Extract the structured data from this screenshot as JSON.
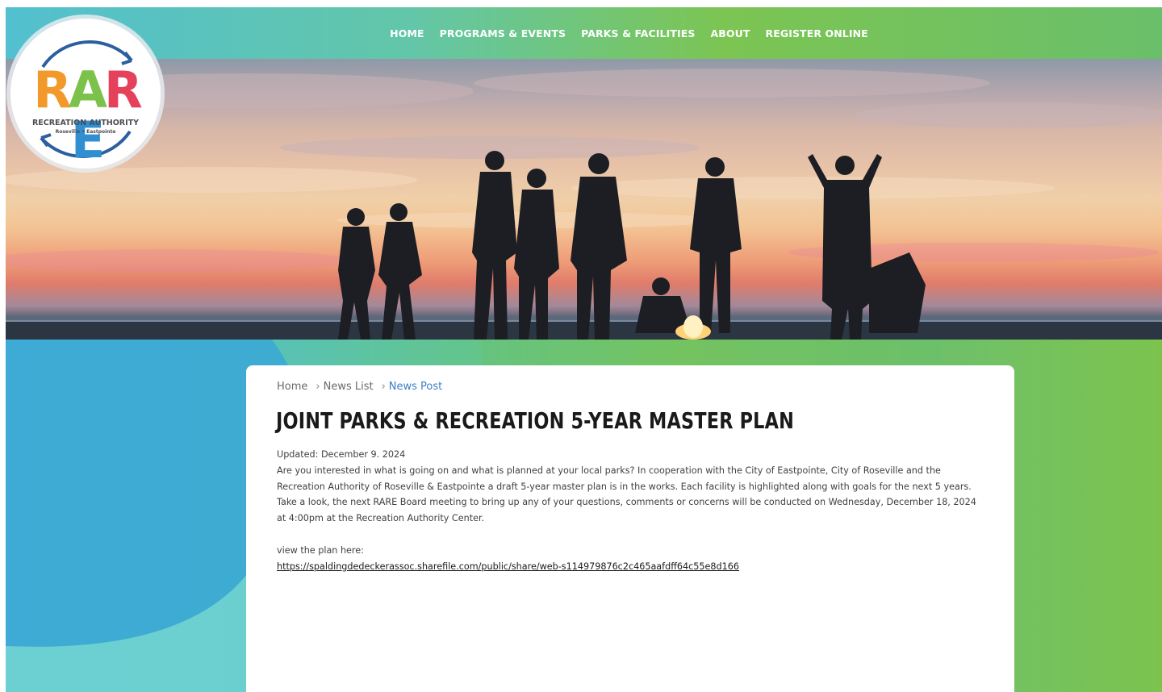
{
  "brand": {
    "logo_letters": [
      "R",
      "A",
      "R",
      "E"
    ],
    "logo_letter_colors": [
      "#f19a2b",
      "#7cc24a",
      "#e5415a",
      "#2f8fd0"
    ],
    "logo_tagline": "RECREATION AUTHORITY",
    "logo_subtitle": "Roseville • Eastpointe",
    "accent_colors": {
      "nav_gradient_start": "#52c0cf",
      "nav_gradient_end": "#7cc553",
      "link_blue": "#3a7fc4"
    }
  },
  "nav": {
    "items": [
      {
        "label": "HOME"
      },
      {
        "label": "PROGRAMS & EVENTS"
      },
      {
        "label": "PARKS & FACILITIES"
      },
      {
        "label": "ABOUT"
      },
      {
        "label": "REGISTER ONLINE"
      }
    ]
  },
  "hero": {
    "image": "sunset-beach-bonfire-silhouettes"
  },
  "breadcrumb": {
    "items": [
      {
        "label": "Home"
      },
      {
        "label": "News List"
      },
      {
        "label": "News Post"
      }
    ],
    "separator": "›"
  },
  "post": {
    "title": "JOINT PARKS & RECREATION 5-YEAR MASTER PLAN",
    "updated": "Updated: December 9. 2024",
    "body_lines": [
      "Are you interested in what is going on and what is planned at your local parks? In cooperation with the City of Eastpointe, City of Roseville and the",
      "Recreation Authority of Roseville & Eastpointe a draft 5-year master plan is in the works. Each facility is highlighted along with goals for the next 5 years.",
      "Take a look, the next RARE Board meeting to bring up any of your questions, comments or concerns will be conducted on Wednesday, December 18, 2024",
      "at 4:00pm at the Recreation Authority Center."
    ],
    "link_intro": "view the plan here:",
    "link_url": "https://spaldingdedeckerassoc.sharefile.com/public/share/web-s114979876c2c465aafdff64c55e8d166"
  }
}
